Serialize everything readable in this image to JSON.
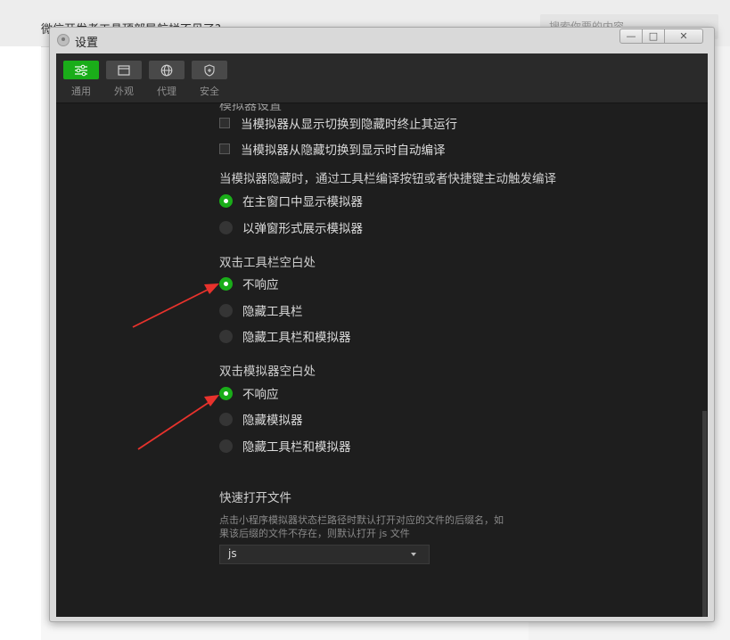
{
  "background": {
    "title_fragment": "微信开发者工具顶部导航栏不见了?",
    "search_placeholder": "搜索你要的内容"
  },
  "window": {
    "title": "设置",
    "controls": {
      "minimize": "—",
      "maximize": "□",
      "close": "✕"
    }
  },
  "toolbar": {
    "tabs": [
      {
        "label": "通用",
        "icon": "sliders-icon",
        "active": true
      },
      {
        "label": "外观",
        "icon": "window-icon",
        "active": false
      },
      {
        "label": "代理",
        "icon": "globe-icon",
        "active": false
      },
      {
        "label": "安全",
        "icon": "shield-icon",
        "active": false
      }
    ]
  },
  "settings": {
    "cut_off_heading": "模拟器设置",
    "checkboxes": [
      {
        "label": "当模拟器从显示切换到隐藏时终止其运行",
        "checked": false
      },
      {
        "label": "当模拟器从隐藏切换到显示时自动编译",
        "checked": false
      }
    ],
    "group_hidden": {
      "title": "当模拟器隐藏时，通过工具栏编译按钮或者快捷键主动触发编译",
      "options": [
        {
          "label": "在主窗口中显示模拟器",
          "selected": true
        },
        {
          "label": "以弹窗形式展示模拟器",
          "selected": false
        }
      ]
    },
    "group_toolbar_dblclick": {
      "title": "双击工具栏空白处",
      "options": [
        {
          "label": "不响应",
          "selected": true
        },
        {
          "label": "隐藏工具栏",
          "selected": false
        },
        {
          "label": "隐藏工具栏和模拟器",
          "selected": false
        }
      ]
    },
    "group_sim_dblclick": {
      "title": "双击模拟器空白处",
      "options": [
        {
          "label": "不响应",
          "selected": true
        },
        {
          "label": "隐藏模拟器",
          "selected": false
        },
        {
          "label": "隐藏工具栏和模拟器",
          "selected": false
        }
      ]
    },
    "quick_open": {
      "title": "快速打开文件",
      "desc_line1": "点击小程序模拟器状态栏路径时默认打开对应的文件的后缀名，如",
      "desc_line2": "果该后缀的文件不存在，则默认打开 js 文件",
      "selected": "js"
    }
  },
  "colors": {
    "accent": "#1aad19",
    "arrow": "#e8322c",
    "panel": "#1e1e1e"
  }
}
